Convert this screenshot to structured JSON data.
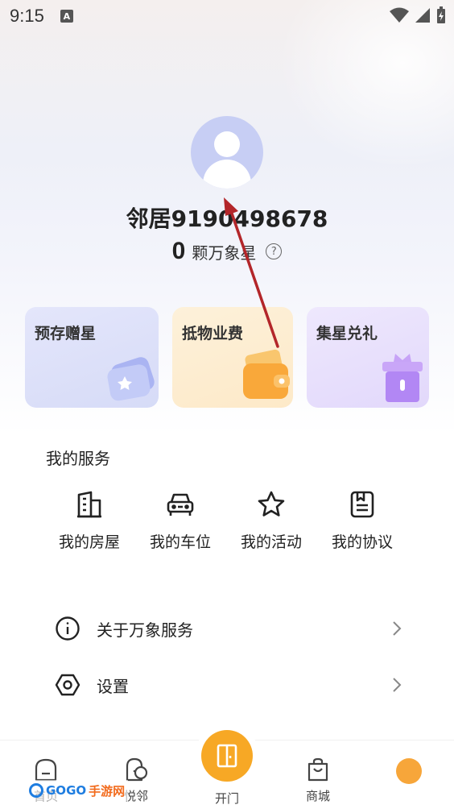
{
  "status_bar": {
    "time": "9:15",
    "notification_icon": "A"
  },
  "profile": {
    "username": "邻居9190498678",
    "stars_count": "0",
    "stars_label": "颗万象星"
  },
  "cards": [
    {
      "label": "预存赠星",
      "icon": "wallet-star-icon"
    },
    {
      "label": "抵物业费",
      "icon": "wallet-icon"
    },
    {
      "label": "集星兑礼",
      "icon": "gift-icon"
    }
  ],
  "services": {
    "title": "我的服务",
    "items": [
      {
        "label": "我的房屋",
        "icon": "building-icon"
      },
      {
        "label": "我的车位",
        "icon": "car-icon"
      },
      {
        "label": "我的活动",
        "icon": "star-icon"
      },
      {
        "label": "我的协议",
        "icon": "document-icon"
      }
    ]
  },
  "menu": [
    {
      "label": "关于万象服务",
      "icon": "info-icon"
    },
    {
      "label": "设置",
      "icon": "settings-icon"
    }
  ],
  "tabbar": {
    "home": "首页",
    "neighbor": "悦邻",
    "open_door": "开门",
    "mall": "商城"
  },
  "watermark": {
    "latin": "GOGO",
    "cn": "手游网"
  },
  "colors": {
    "accent": "#f7a825",
    "avatar_bg": "#c7cef4",
    "annotation_arrow": "#b3262a"
  }
}
